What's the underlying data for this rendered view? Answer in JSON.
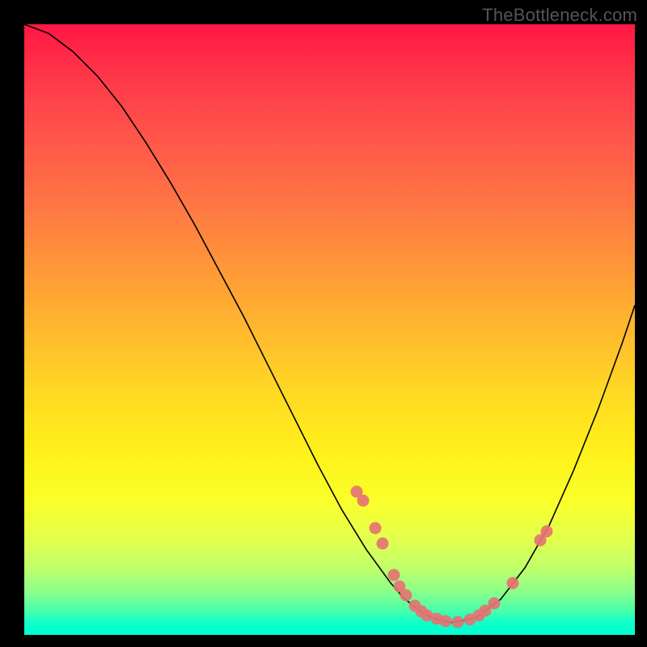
{
  "watermark": "TheBottleneck.com",
  "chart_data": {
    "type": "line",
    "title": "",
    "xlabel": "",
    "ylabel": "",
    "xlim": [
      0,
      100
    ],
    "ylim": [
      0,
      100
    ],
    "curve": {
      "x": [
        0,
        4,
        8,
        12,
        16,
        20,
        24,
        28,
        32,
        36,
        40,
        44,
        48,
        52,
        56,
        60,
        62,
        64,
        66,
        68,
        70,
        74,
        78,
        82,
        86,
        90,
        94,
        98,
        100
      ],
      "y": [
        100,
        98.5,
        95.5,
        91.5,
        86.5,
        80.5,
        74,
        67,
        59.5,
        52,
        44,
        36,
        28,
        20.5,
        14,
        8.5,
        6.2,
        4.5,
        3.2,
        2.4,
        2.0,
        2.8,
        5.8,
        11,
        18,
        27,
        37,
        48,
        54
      ]
    },
    "scatter_points": [
      {
        "x": 54.5,
        "y": 23.5
      },
      {
        "x": 55.5,
        "y": 22
      },
      {
        "x": 57.5,
        "y": 17.5
      },
      {
        "x": 58.7,
        "y": 15
      },
      {
        "x": 60.5,
        "y": 9.8
      },
      {
        "x": 61.5,
        "y": 8
      },
      {
        "x": 62.5,
        "y": 6.5
      },
      {
        "x": 64,
        "y": 4.8
      },
      {
        "x": 65,
        "y": 3.8
      },
      {
        "x": 66,
        "y": 3.2
      },
      {
        "x": 67.5,
        "y": 2.6
      },
      {
        "x": 69,
        "y": 2.2
      },
      {
        "x": 71,
        "y": 2.1
      },
      {
        "x": 73,
        "y": 2.5
      },
      {
        "x": 74.5,
        "y": 3.2
      },
      {
        "x": 75.5,
        "y": 4.0
      },
      {
        "x": 77,
        "y": 5.2
      },
      {
        "x": 80,
        "y": 8.5
      },
      {
        "x": 84.5,
        "y": 15.5
      },
      {
        "x": 85.5,
        "y": 17
      }
    ],
    "gradient_stops": [
      {
        "pos": 0,
        "color": "#ff1744"
      },
      {
        "pos": 50,
        "color": "#ffd824"
      },
      {
        "pos": 100,
        "color": "#00ffd0"
      }
    ]
  }
}
